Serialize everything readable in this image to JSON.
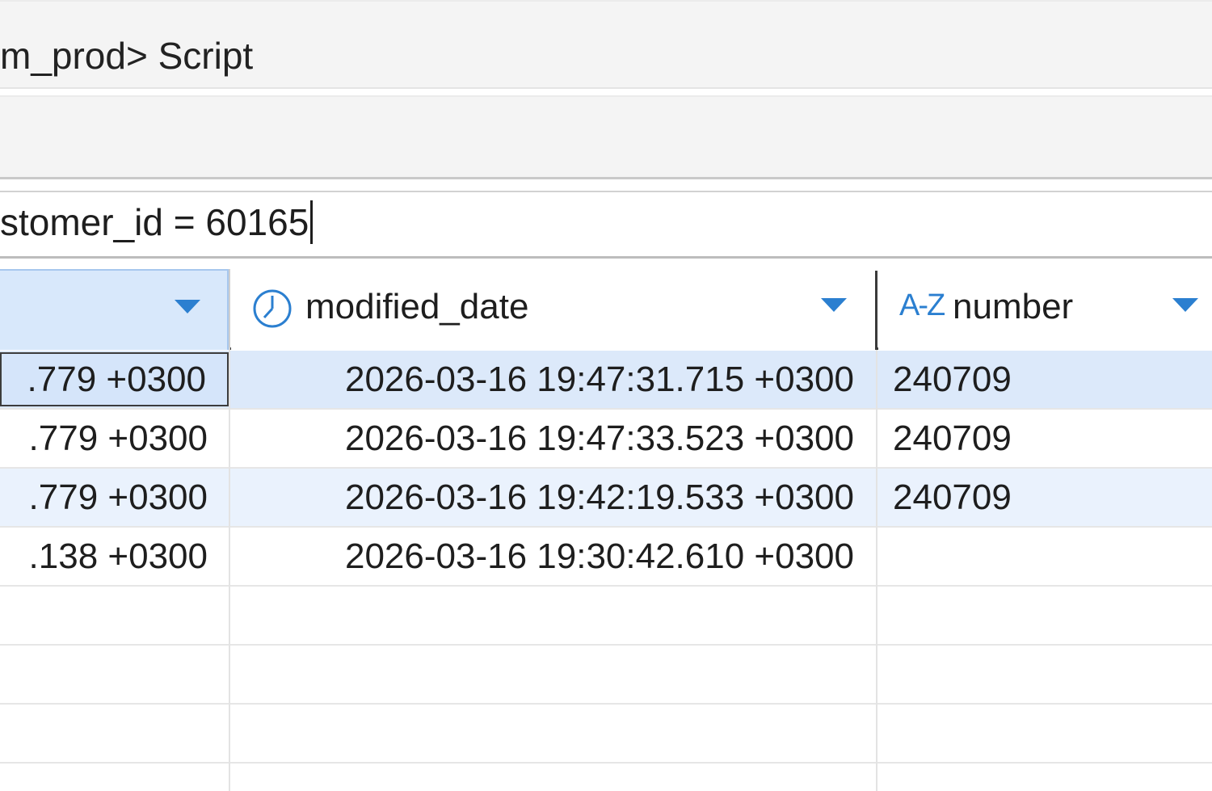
{
  "window": {
    "title": "m_prod> Script"
  },
  "filter": {
    "value": "stomer_id = 60165"
  },
  "grid": {
    "columns": [
      {
        "label": "",
        "icon": "none"
      },
      {
        "label": "modified_date",
        "icon": "clock-icon"
      },
      {
        "label": "number",
        "icon": "az-icon",
        "icon_text": "A-Z"
      }
    ],
    "rows": [
      [
        ".779 +0300",
        "2026-03-16 19:47:31.715 +0300",
        "240709"
      ],
      [
        ".779 +0300",
        "2026-03-16 19:47:33.523 +0300",
        "240709"
      ],
      [
        ".779 +0300",
        "2026-03-16 19:42:19.533 +0300",
        "240709"
      ],
      [
        ".138 +0300",
        "2026-03-16 19:30:42.610 +0300",
        ""
      ]
    ]
  },
  "colors": {
    "accent": "#2b7fd0",
    "selected_row": "#dce9fa",
    "alt_row": "#eaf2fd"
  }
}
